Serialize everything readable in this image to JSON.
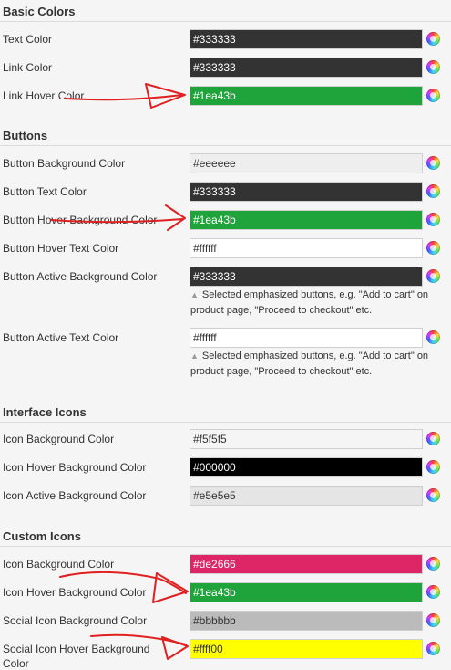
{
  "sections": {
    "basic": {
      "title": "Basic Colors",
      "rows": [
        {
          "label": "Text Color",
          "value": "#333333",
          "bg": "#333333",
          "fg": "#ffffff"
        },
        {
          "label": "Link Color",
          "value": "#333333",
          "bg": "#333333",
          "fg": "#ffffff"
        },
        {
          "label": "Link Hover Color",
          "value": "#1ea43b",
          "bg": "#1ea43b",
          "fg": "#ffffff"
        }
      ]
    },
    "buttons": {
      "title": "Buttons",
      "rows": [
        {
          "label": "Button Background Color",
          "value": "#eeeeee",
          "bg": "#eeeeee",
          "fg": "#333333"
        },
        {
          "label": "Button Text Color",
          "value": "#333333",
          "bg": "#333333",
          "fg": "#ffffff"
        },
        {
          "label": "Button Hover Background Color",
          "value": "#1ea43b",
          "bg": "#1ea43b",
          "fg": "#ffffff"
        },
        {
          "label": "Button Hover Text Color",
          "value": "#ffffff",
          "bg": "#ffffff",
          "fg": "#333333"
        },
        {
          "label": "Button Active Background Color",
          "value": "#333333",
          "bg": "#333333",
          "fg": "#ffffff",
          "hint": [
            "Selected emphasized buttons, e.g. \"Add to cart\" on",
            "product page, \"Proceed to checkout\" etc."
          ]
        },
        {
          "label": "Button Active Text Color",
          "value": "#ffffff",
          "bg": "#ffffff",
          "fg": "#333333",
          "hint": [
            "Selected emphasized buttons, e.g. \"Add to cart\" on",
            "product page, \"Proceed to checkout\" etc."
          ]
        }
      ]
    },
    "interface": {
      "title": "Interface Icons",
      "rows": [
        {
          "label": "Icon Background Color",
          "value": "#f5f5f5",
          "bg": "#f5f5f5",
          "fg": "#333333"
        },
        {
          "label": "Icon Hover Background Color",
          "value": "#000000",
          "bg": "#000000",
          "fg": "#ffffff"
        },
        {
          "label": "Icon Active Background Color",
          "value": "#e5e5e5",
          "bg": "#e5e5e5",
          "fg": "#333333"
        }
      ]
    },
    "custom": {
      "title": "Custom Icons",
      "rows": [
        {
          "label": "Icon Background Color",
          "value": "#de2666",
          "bg": "#de2666",
          "fg": "#ffffff"
        },
        {
          "label": "Icon Hover Background Color",
          "value": "#1ea43b",
          "bg": "#1ea43b",
          "fg": "#ffffff"
        },
        {
          "label": "Social Icon Background Color",
          "value": "#bbbbbb",
          "bg": "#bbbbbb",
          "fg": "#333333"
        },
        {
          "label": "Social Icon Hover Background",
          "label_cont": "Color",
          "value": "#ffff00",
          "bg": "#ffff00",
          "fg": "#333333"
        }
      ]
    }
  },
  "icons": {
    "picker": "color-wheel-icon",
    "hint": "triangle-up-icon"
  },
  "annotation_color": "#e02020"
}
